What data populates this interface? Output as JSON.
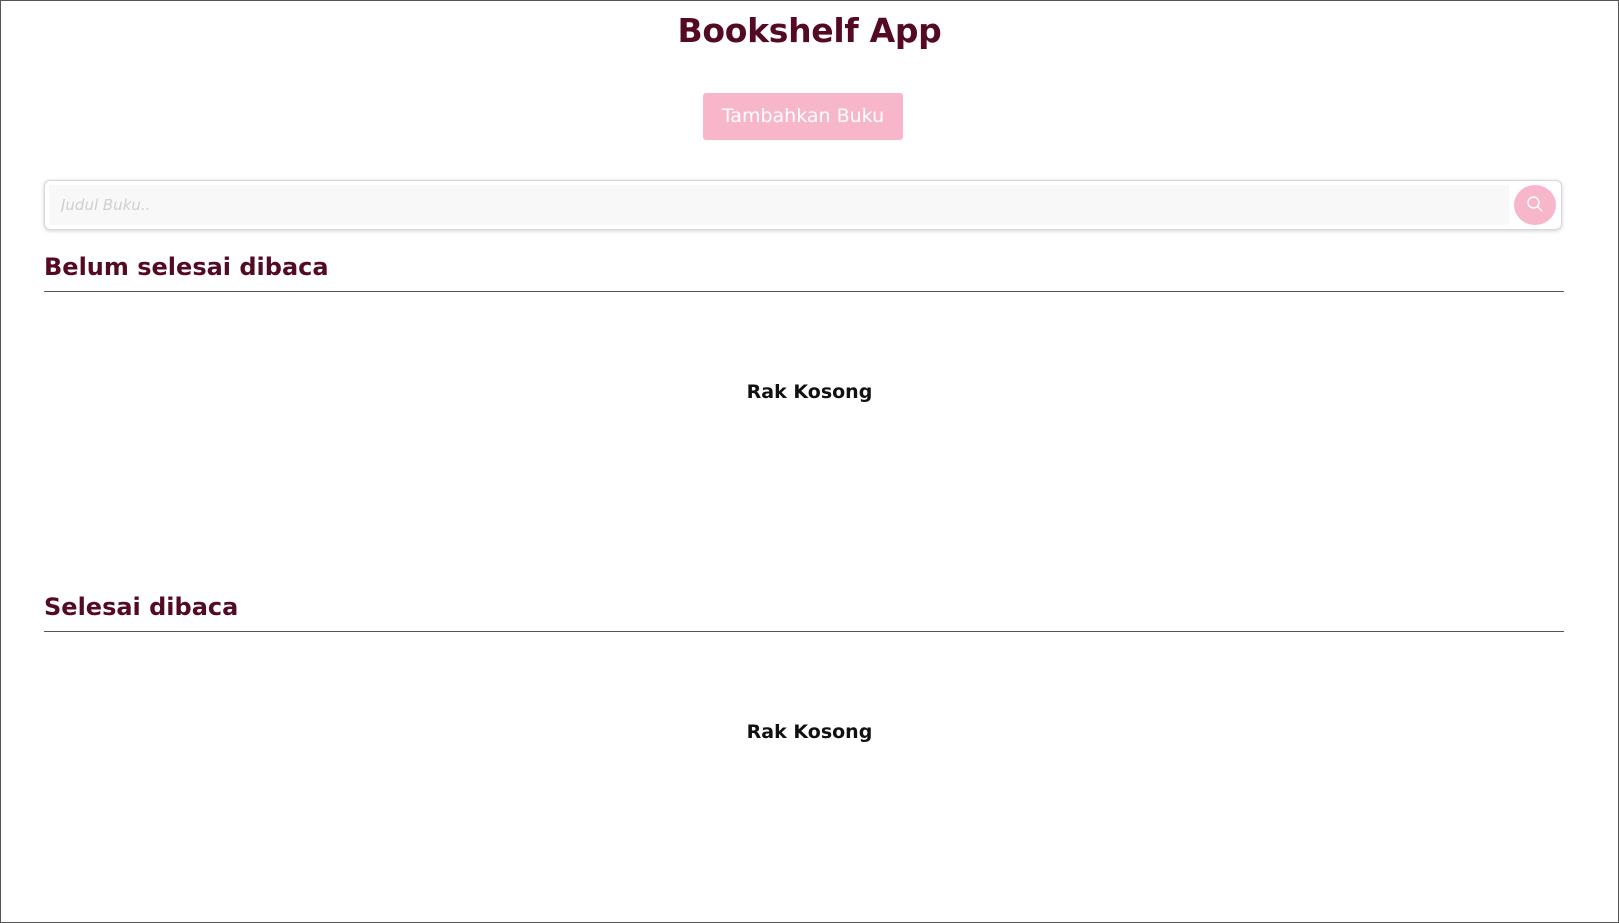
{
  "app": {
    "title": "Bookshelf App",
    "add_button_label": "Tambahkan Buku"
  },
  "search": {
    "placeholder": "Judul Buku..",
    "value": "",
    "button_icon": "search-icon"
  },
  "shelves": [
    {
      "heading": "Belum selesai dibaca",
      "empty_text": "Rak Kosong"
    },
    {
      "heading": "Selesai dibaca",
      "empty_text": "Rak Kosong"
    }
  ],
  "colors": {
    "title": "#550a24",
    "accent": "#f7b6c9",
    "divider": "#555555"
  }
}
